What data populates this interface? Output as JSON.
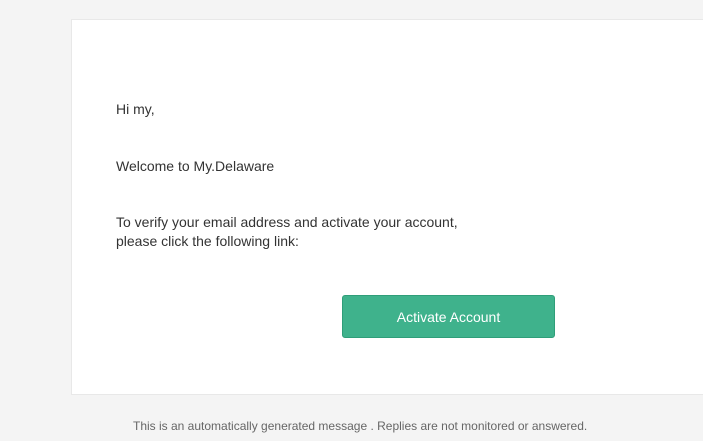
{
  "email": {
    "greeting": "Hi my,",
    "welcome": "Welcome to My.Delaware",
    "verify_line_1": "To verify your email address and activate your account,",
    "verify_line_2": "please click the following link:",
    "activate_button_label": "Activate Account"
  },
  "footer": {
    "note": "This is an automatically generated message . Replies are not monitored or answered."
  },
  "colors": {
    "page_background": "#f4f4f4",
    "card_background": "#ffffff",
    "button_accent": "#3fb28c",
    "body_text": "#333333"
  }
}
